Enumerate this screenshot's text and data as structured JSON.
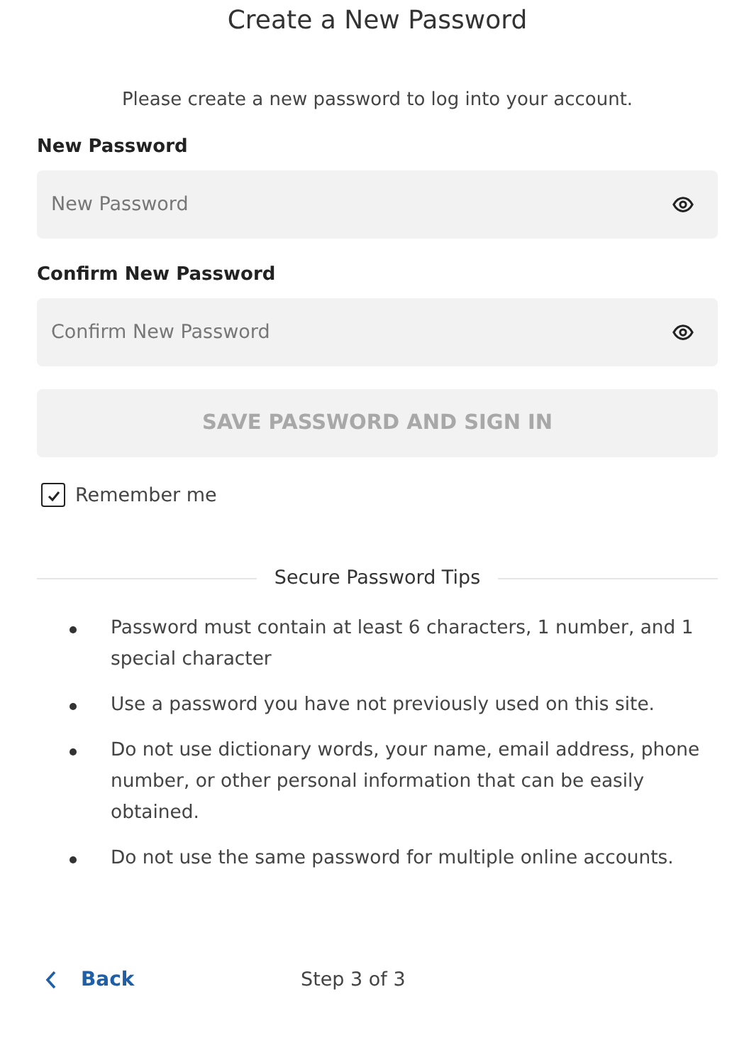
{
  "title": "Create a New Password",
  "subtitle": "Please create a new password to log into your account.",
  "fields": [
    {
      "label": "New Password",
      "placeholder": "New Password"
    },
    {
      "label": "Confirm New Password",
      "placeholder": "Confirm New Password"
    }
  ],
  "submit": {
    "label": "SAVE PASSWORD AND SIGN IN",
    "disabled": true
  },
  "remember": {
    "label": "Remember me",
    "checked": true
  },
  "tips": {
    "heading": "Secure Password Tips",
    "items": [
      "Password must contain at least 6 characters, 1 number, and 1 special character",
      "Use a password you have not previously used on this site.",
      "Do not use dictionary words, your name, email address, phone number, or other personal information that can be easily obtained.",
      "Do not use the same password for multiple online accounts."
    ]
  },
  "footer": {
    "back": "Back",
    "step": "Step 3 of 3"
  }
}
